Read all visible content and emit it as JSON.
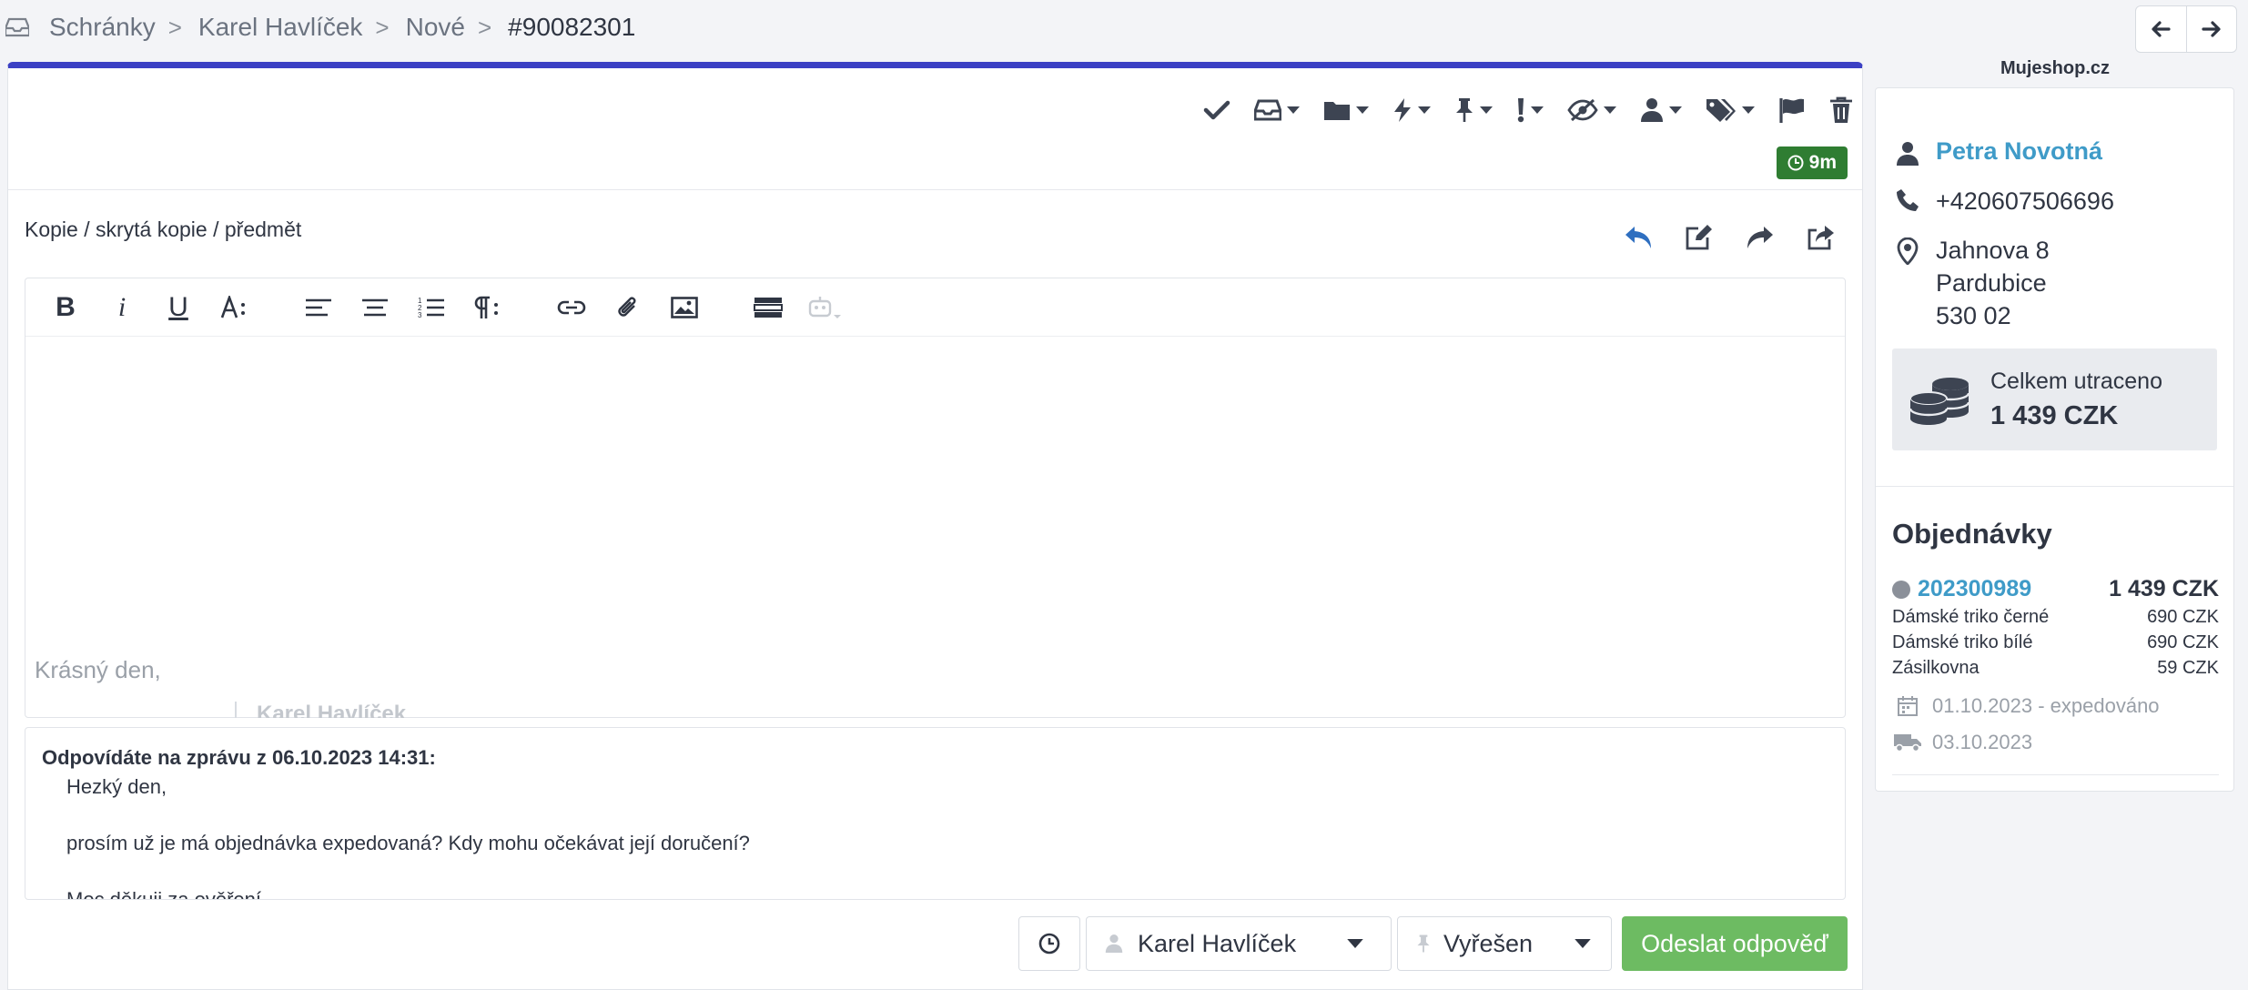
{
  "breadcrumb": {
    "items": [
      {
        "label": "Schránky"
      },
      {
        "label": "Karel Havlíček"
      },
      {
        "label": "Nové"
      },
      {
        "label": "#90082301"
      }
    ],
    "separator": ">"
  },
  "ticket": {
    "timer": "9m",
    "cc_link": "Kopie / skrytá kopie / předmět"
  },
  "editor": {
    "greeting": "Krásný den,",
    "signature": "Karel Havlíček"
  },
  "quote": {
    "header": "Odpovídáte na zprávu z 06.10.2023 14:31:",
    "lines": [
      "Hezký den,",
      "prosím už je má objednávka expedovaná? Kdy mohu očekávat její doručení?",
      "Moc děkuji za ověření"
    ]
  },
  "footer": {
    "assignee": "Karel Havlíček",
    "status": "Vyřešen",
    "send_label": "Odeslat odpověď"
  },
  "sidebar": {
    "shop_name": "Mujeshop.cz",
    "customer": {
      "name": "Petra Novotná",
      "phone": "+420607506696",
      "address": [
        "Jahnova 8",
        "Pardubice",
        "530 02"
      ]
    },
    "spent": {
      "label": "Celkem utraceno",
      "value": "1 439 CZK"
    },
    "orders": {
      "title": "Objednávky",
      "list": [
        {
          "number": "202300989",
          "total": "1 439 CZK",
          "items": [
            {
              "name": "Dámské triko černé",
              "price": "690 CZK"
            },
            {
              "name": "Dámské triko bílé",
              "price": "690 CZK"
            },
            {
              "name": "Zásilkovna",
              "price": "59 CZK"
            }
          ],
          "shipped": "01.10.2023 - expedováno",
          "delivery": "03.10.2023"
        }
      ]
    }
  },
  "colors": {
    "accent": "#3b40c4",
    "link": "#3f9bc8",
    "timer": "#2f7d32",
    "send": "#6dbb62",
    "icon": "#3d4452"
  }
}
